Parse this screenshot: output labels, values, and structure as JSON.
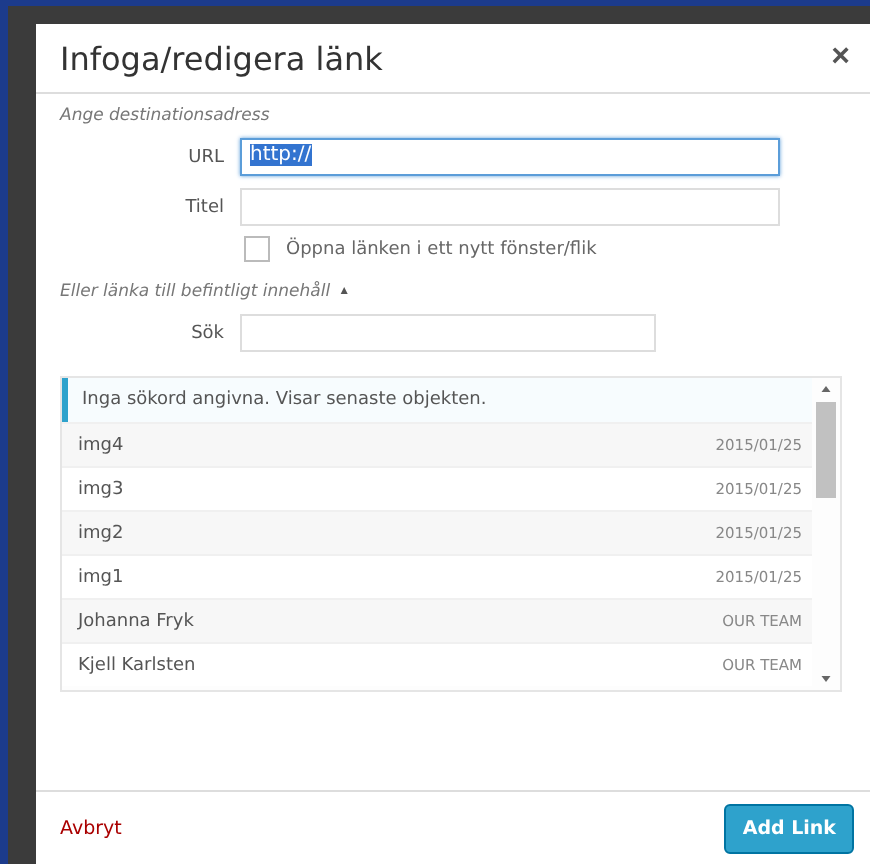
{
  "dialog": {
    "title": "Infoga/redigera länk",
    "close": "×"
  },
  "section_heading": "Ange destinationsadress",
  "url": {
    "label": "URL",
    "value": "http://",
    "selected": true
  },
  "title_field": {
    "label": "Titel"
  },
  "new_window": {
    "label": "Öppna länken i ett nytt fönster/flik",
    "checked": false
  },
  "existing": {
    "label": "Eller länka till befintligt innehåll",
    "toggle": "▲",
    "expanded": true
  },
  "search": {
    "label": "Sök"
  },
  "results": {
    "notice": "Inga sökord angivna. Visar senaste objekten.",
    "rows": [
      {
        "title": "img4",
        "info": "2015/01/25"
      },
      {
        "title": "img3",
        "info": "2015/01/25"
      },
      {
        "title": "img2",
        "info": "2015/01/25"
      },
      {
        "title": "img1",
        "info": "2015/01/25"
      },
      {
        "title": "Johanna Fryk",
        "info": "OUR TEAM"
      },
      {
        "title": "Kjell Karlsten",
        "info": "OUR TEAM"
      }
    ]
  },
  "buttons": {
    "cancel": "Avbryt",
    "submit": "Add Link"
  }
}
